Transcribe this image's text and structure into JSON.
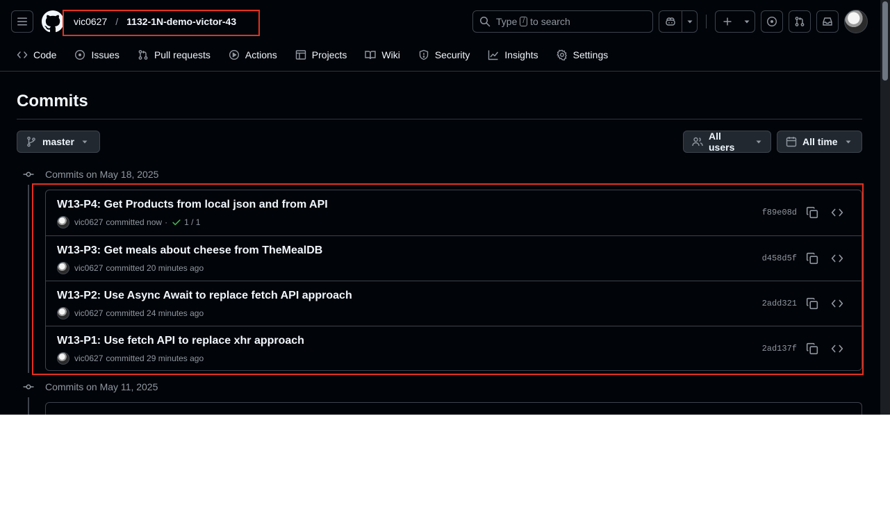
{
  "header": {
    "owner": "vic0627",
    "separator": "/",
    "repo": "1132-1N-demo-victor-43",
    "search": {
      "prefix": "Type",
      "key": "/",
      "suffix": "to search"
    }
  },
  "nav": [
    {
      "label": "Code",
      "icon": "code-icon"
    },
    {
      "label": "Issues",
      "icon": "issue-opened-icon"
    },
    {
      "label": "Pull requests",
      "icon": "git-pull-request-icon"
    },
    {
      "label": "Actions",
      "icon": "play-icon"
    },
    {
      "label": "Projects",
      "icon": "table-icon"
    },
    {
      "label": "Wiki",
      "icon": "book-icon"
    },
    {
      "label": "Security",
      "icon": "shield-icon"
    },
    {
      "label": "Insights",
      "icon": "graph-icon"
    },
    {
      "label": "Settings",
      "icon": "gear-icon"
    }
  ],
  "page": {
    "title": "Commits",
    "branch": "master",
    "users_filter": "All users",
    "time_filter": "All time"
  },
  "groups": [
    {
      "heading": "Commits on May 18, 2025",
      "commits": [
        {
          "message": "W13-P4: Get Products from local json and from API",
          "author": "vic0627",
          "time": "committed now",
          "checks": "1 / 1",
          "sha": "f89e08d"
        },
        {
          "message": "W13-P3: Get meals about cheese from TheMealDB",
          "author": "vic0627",
          "time": "committed 20 minutes ago",
          "checks": "",
          "sha": "d458d5f"
        },
        {
          "message": "W13-P2: Use Async Await to replace fetch API approach",
          "author": "vic0627",
          "time": "committed 24 minutes ago",
          "checks": "",
          "sha": "2add321"
        },
        {
          "message": "W13-P1: Use fetch API to replace xhr approach",
          "author": "vic0627",
          "time": "committed 29 minutes ago",
          "checks": "",
          "sha": "2ad137f"
        }
      ]
    },
    {
      "heading": "Commits on May 11, 2025",
      "commits": []
    }
  ],
  "colors": {
    "background": "#010409",
    "border": "#3d444d",
    "text": "#f0f6fc",
    "muted": "#9198a1",
    "success": "#3fb950",
    "highlight": "#e5311f"
  }
}
